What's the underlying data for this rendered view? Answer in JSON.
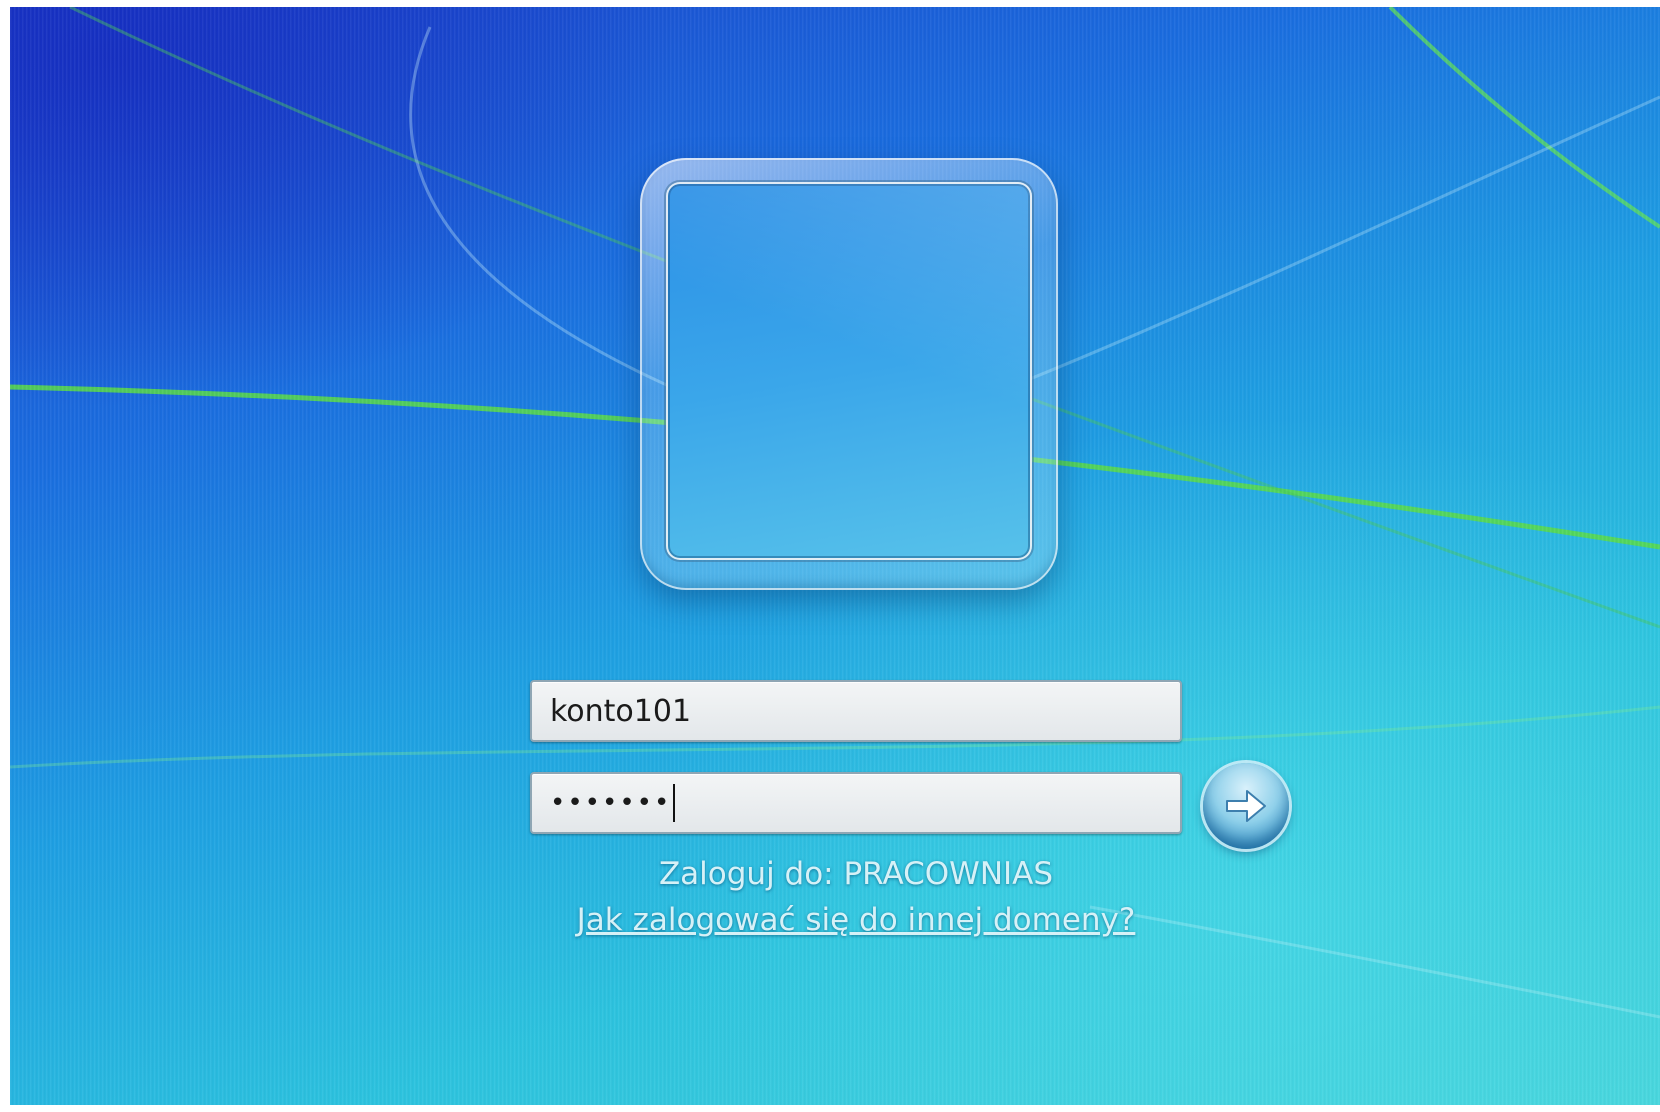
{
  "login": {
    "username_value": "konto101",
    "password_masked": "•••••••",
    "domain_text": "Zaloguj do: PRACOWNIAS",
    "other_domain_link": "Jak zalogować się do innej domeny?"
  },
  "icons": {
    "submit": "arrow-right-icon",
    "user_tile": "user-picture-frame"
  },
  "colors": {
    "background_top_left": "#1c3fcb",
    "background_bottom_right": "#48d6dc",
    "text_light": "#d6f1f7"
  }
}
